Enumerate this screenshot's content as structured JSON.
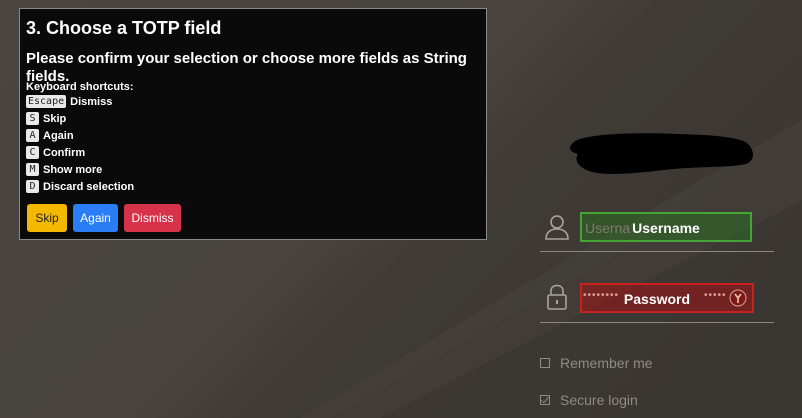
{
  "dialog": {
    "title": "3. Choose a TOTP field",
    "subtitle": "Please confirm your selection or choose more fields as String fields.",
    "shortcuts_heading": "Keyboard shortcuts:",
    "shortcuts": [
      {
        "key": "Escape",
        "label": "Dismiss"
      },
      {
        "key": "S",
        "label": "Skip"
      },
      {
        "key": "A",
        "label": "Again"
      },
      {
        "key": "C",
        "label": "Confirm"
      },
      {
        "key": "M",
        "label": "Show more"
      },
      {
        "key": "D",
        "label": "Discard selection"
      }
    ],
    "buttons": {
      "skip": "Skip",
      "again": "Again",
      "dismiss": "Dismiss"
    }
  },
  "login": {
    "username": {
      "placeholder": "Userna",
      "overlay_label": "Username",
      "icon": "user-icon"
    },
    "password": {
      "dots": "••••••••",
      "dots_right": "•••••",
      "overlay_label": "Password",
      "icon": "lock-icon",
      "badge_icon": "key-badge-icon"
    },
    "remember_me": {
      "label": "Remember me",
      "checked": false
    },
    "secure_login": {
      "label": "Secure login",
      "checked": true
    }
  },
  "colors": {
    "skip": "#f5b800",
    "again": "#2b7df6",
    "dismiss": "#d6324a",
    "username_highlight": "#43a533",
    "password_highlight": "#c81f1f"
  }
}
